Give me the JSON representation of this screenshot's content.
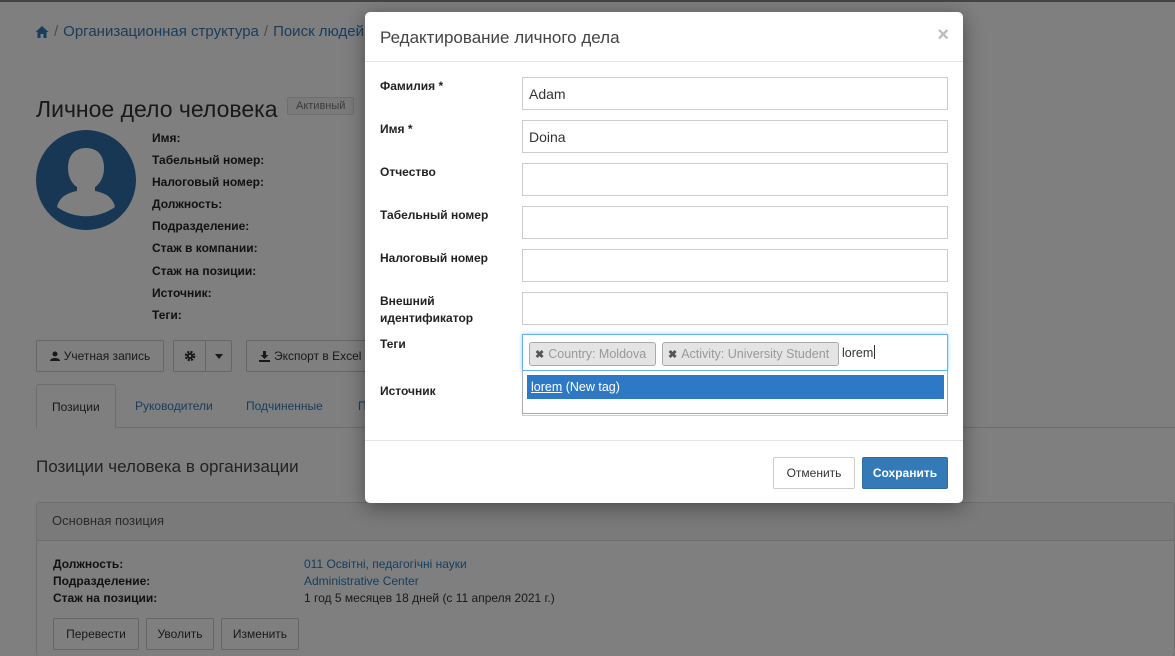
{
  "breadcrumb": {
    "items": [
      "Организационная структура",
      "Поиск людей"
    ]
  },
  "person": {
    "title": "Личное дело человека",
    "status": "Активный",
    "fields": [
      "Имя:",
      "Табельный номер:",
      "Налоговый номер:",
      "Должность:",
      "Подразделение:",
      "Стаж в компании:",
      "Стаж на позиции:",
      "Источник:",
      "Теги:"
    ]
  },
  "actions": {
    "account": "Учетная запись",
    "export": "Экспорт в Excel"
  },
  "tabs": [
    "Позиции",
    "Руководители",
    "Подчиненные",
    "П"
  ],
  "positions": {
    "section_title": "Позиции человека в организации",
    "panel_title": "Основная позиция",
    "rows": [
      {
        "key": "Должность:",
        "value": "011 Освітні, педагогічні науки"
      },
      {
        "key": "Подразделение:",
        "value": "Administrative Center"
      },
      {
        "key": "Стаж на позиции:",
        "value": "1 год 5 месяцев 18 дней (с 11 апреля 2021 г.)"
      }
    ],
    "buttons": [
      "Перевести",
      "Уволить",
      "Изменить"
    ]
  },
  "modal": {
    "title": "Редактирование личного дела",
    "close": "×",
    "labels": {
      "last_name": "Фамилия *",
      "first_name": "Имя *",
      "patronymic": "Отчество",
      "employee_no": "Табельный номер",
      "tax_no": "Налоговый номер",
      "external_id": "Внешний идентификатор",
      "tags": "Теги",
      "source": "Источник"
    },
    "values": {
      "last_name": "Adam",
      "first_name": "Doina",
      "patronymic": "",
      "employee_no": "",
      "tax_no": "",
      "external_id": ""
    },
    "tags": [
      "Country: Moldova",
      "Activity: University Student"
    ],
    "tag_input": "lorem",
    "suggestion": {
      "match": "lorem",
      "suffix": " (New tag)"
    },
    "cancel": "Отменить",
    "save": "Сохранить"
  },
  "colors": {
    "primary": "#337ab7",
    "avatar": "#2f6fa8",
    "highlight": "#2d79c6"
  }
}
